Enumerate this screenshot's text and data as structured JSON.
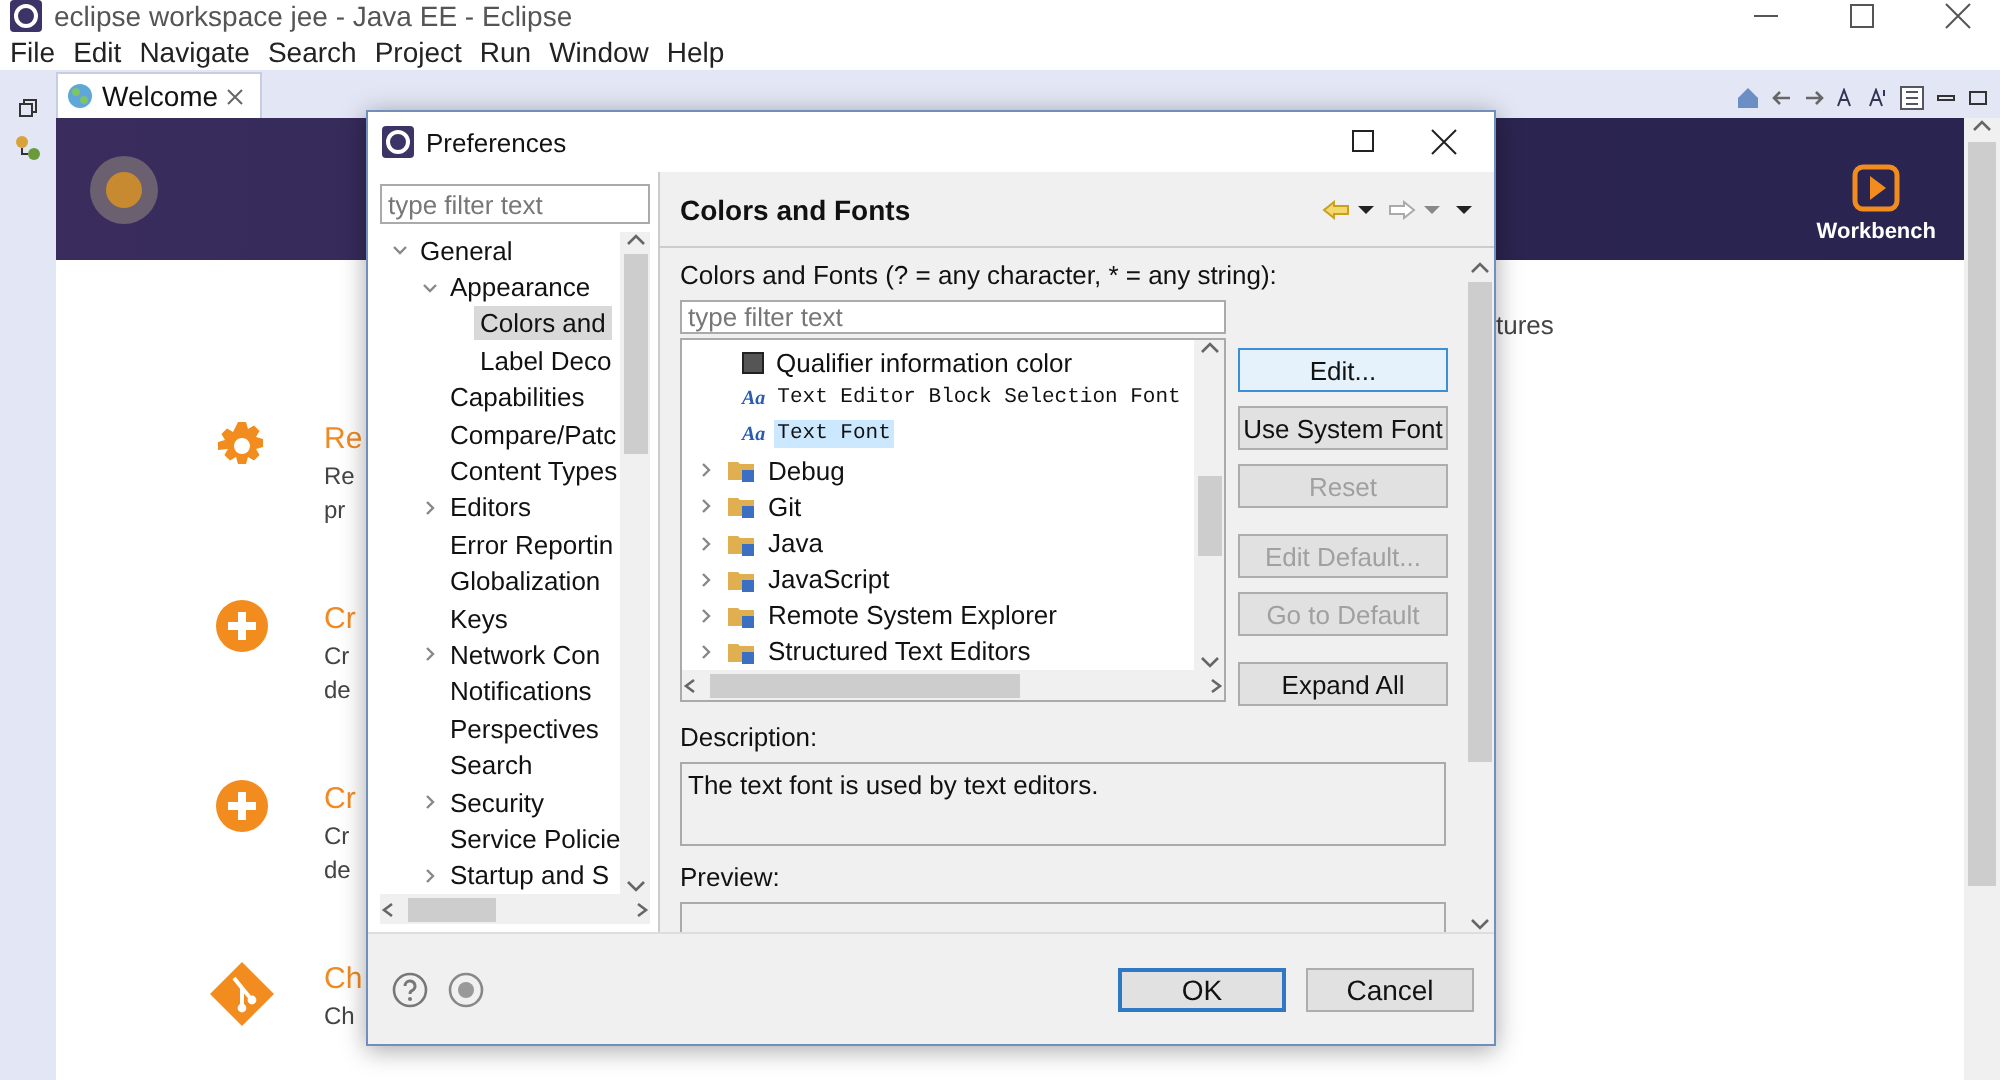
{
  "window": {
    "title": "eclipse workspace jee - Java EE - Eclipse"
  },
  "menu": [
    "File",
    "Edit",
    "Navigate",
    "Search",
    "Project",
    "Run",
    "Window",
    "Help"
  ],
  "editor_tab": {
    "label": "Welcome",
    "selected": true
  },
  "welcome": {
    "banner_action": "Workbench",
    "items": [
      {
        "kind": "gear",
        "title": "Re",
        "lines": [
          "Re",
          "pr"
        ]
      },
      {
        "kind": "plus",
        "title": "Cr",
        "lines": [
          "Cr",
          "de"
        ]
      },
      {
        "kind": "plus",
        "title": "Cr",
        "lines": [
          "Cr",
          "de"
        ]
      },
      {
        "kind": "git",
        "title": "Ch",
        "lines": [
          "Ch"
        ]
      }
    ],
    "overflow_text": "tures"
  },
  "dialog": {
    "title": "Preferences",
    "filter_placeholder": "type filter text",
    "nav_tree": [
      {
        "label": "General",
        "expanded": true,
        "selected": false,
        "children": [
          {
            "label": "Appearance",
            "expanded": true,
            "selected": false,
            "children": [
              {
                "label": "Colors and",
                "selected": true
              },
              {
                "label": "Label Deco",
                "selected": false
              }
            ]
          },
          {
            "label": "Capabilities",
            "selected": false
          },
          {
            "label": "Compare/Patc",
            "selected": false
          },
          {
            "label": "Content Types",
            "selected": false
          },
          {
            "label": "Editors",
            "expanded": false,
            "selected": false
          },
          {
            "label": "Error Reportin",
            "selected": false
          },
          {
            "label": "Globalization",
            "selected": false
          },
          {
            "label": "Keys",
            "selected": false
          },
          {
            "label": "Network Con",
            "expanded": false,
            "selected": false
          },
          {
            "label": "Notifications",
            "selected": false
          },
          {
            "label": "Perspectives",
            "selected": false
          },
          {
            "label": "Search",
            "selected": false
          },
          {
            "label": "Security",
            "expanded": false,
            "selected": false
          },
          {
            "label": "Service Policie",
            "selected": false
          },
          {
            "label": "Startup and S",
            "expanded": false,
            "selected": false
          }
        ]
      }
    ],
    "page_title": "Colors and Fonts",
    "filter_label": "Colors and Fonts (? = any character, * = any string):",
    "page_filter_placeholder": "type filter text",
    "items": [
      {
        "kind": "color",
        "label": "Qualifier information color",
        "selected": false
      },
      {
        "kind": "font",
        "glyph": "Aa",
        "label": "Text Editor Block Selection Font",
        "selected": false
      },
      {
        "kind": "font",
        "glyph": "Aa",
        "label": "Text Font",
        "selected": true
      },
      {
        "kind": "category",
        "label": "Debug",
        "expanded": false,
        "selected": false
      },
      {
        "kind": "category",
        "label": "Git",
        "expanded": false,
        "selected": false
      },
      {
        "kind": "category",
        "label": "Java",
        "expanded": false,
        "selected": false
      },
      {
        "kind": "category",
        "label": "JavaScript",
        "expanded": false,
        "selected": false
      },
      {
        "kind": "category",
        "label": "Remote System Explorer",
        "expanded": false,
        "selected": false
      },
      {
        "kind": "category",
        "label": "Structured Text Editors",
        "expanded": false,
        "selected": false
      }
    ],
    "buttons": [
      {
        "label": "Edit...",
        "disabled": false,
        "focused": true
      },
      {
        "label": "Use System Font",
        "disabled": false,
        "focused": false
      },
      {
        "label": "Reset",
        "disabled": true,
        "focused": false
      },
      {
        "label": "Edit Default...",
        "disabled": true,
        "focused": false
      },
      {
        "label": "Go to Default",
        "disabled": true,
        "focused": false
      },
      {
        "label": "Expand All",
        "disabled": false,
        "focused": false
      }
    ],
    "description_label": "Description:",
    "description": "The text font is used by text editors.",
    "preview_label": "Preview:",
    "footer_buttons": [
      {
        "label": "OK",
        "default": true
      },
      {
        "label": "Cancel",
        "default": false
      }
    ]
  }
}
